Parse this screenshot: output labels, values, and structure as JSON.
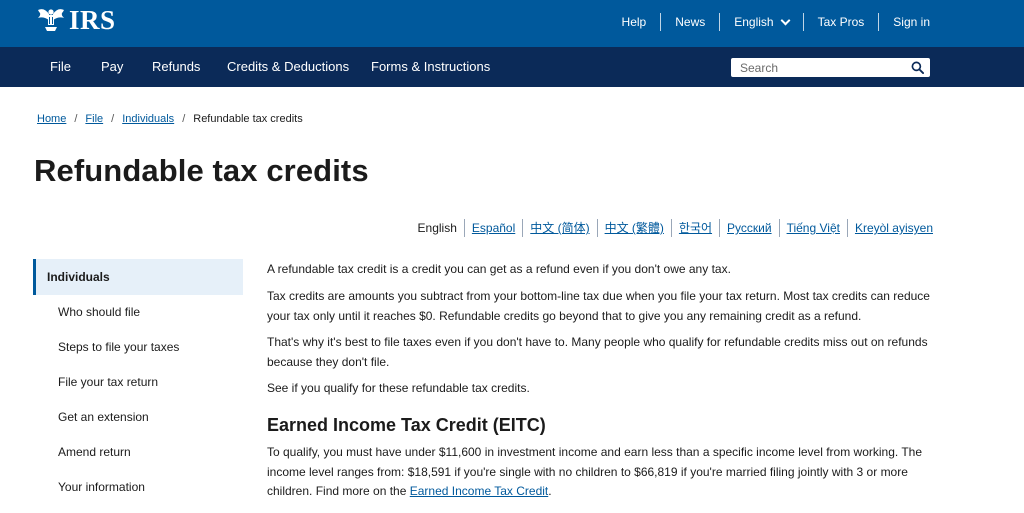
{
  "header": {
    "logo_text": "IRS",
    "utility_nav": [
      {
        "label": "Help"
      },
      {
        "label": "News"
      },
      {
        "label": "English"
      },
      {
        "label": "Tax Pros"
      },
      {
        "label": "Sign in"
      }
    ]
  },
  "main_nav": {
    "items": [
      "File",
      "Pay",
      "Refunds",
      "Credits & Deductions",
      "Forms & Instructions"
    ],
    "search_placeholder": "Search"
  },
  "breadcrumb": {
    "links": [
      "Home",
      "File",
      "Individuals"
    ],
    "current": "Refundable tax credits"
  },
  "page_title": "Refundable tax credits",
  "languages": {
    "current": "English",
    "links": [
      "Español",
      "中文 (简体)",
      "中文 (繁體)",
      "한국어",
      "Русский",
      "Tiếng Việt",
      "Kreyòl ayisyen"
    ]
  },
  "sidebar": {
    "active": "Individuals",
    "items": [
      "Who should file",
      "Steps to file your taxes",
      "File your tax return",
      "Get an extension",
      "Amend return",
      "Your information"
    ]
  },
  "content": {
    "p1": "A refundable tax credit is a credit you can get as a refund even if you don't owe any tax.",
    "p2": "Tax credits are amounts you subtract from your bottom-line tax due when you file your tax return. Most tax credits can reduce your tax only until it reaches $0. Refundable credits go beyond that to give you any remaining credit as a refund.",
    "p3": "That's why it's best to file taxes even if you don't have to. Many people who qualify for refundable credits miss out on refunds because they don't file.",
    "p4": "See if you qualify for these refundable tax credits.",
    "eitc_heading": "Earned Income Tax Credit (EITC)",
    "eitc_text": "To qualify, you must have under $11,600 in investment income and earn less than a specific income level from working. The income level ranges from: $18,591 if you're single with no children to $66,819 if you're married filing jointly with 3 or more children. Find more on the",
    "eitc_link": "Earned Income Tax Credit",
    "eitc_end": "."
  },
  "colors": {
    "header_blue": "#00599c",
    "nav_navy": "#0b2a58",
    "link_blue": "#00599c",
    "sidebar_active_bg": "#e6f0f9"
  }
}
